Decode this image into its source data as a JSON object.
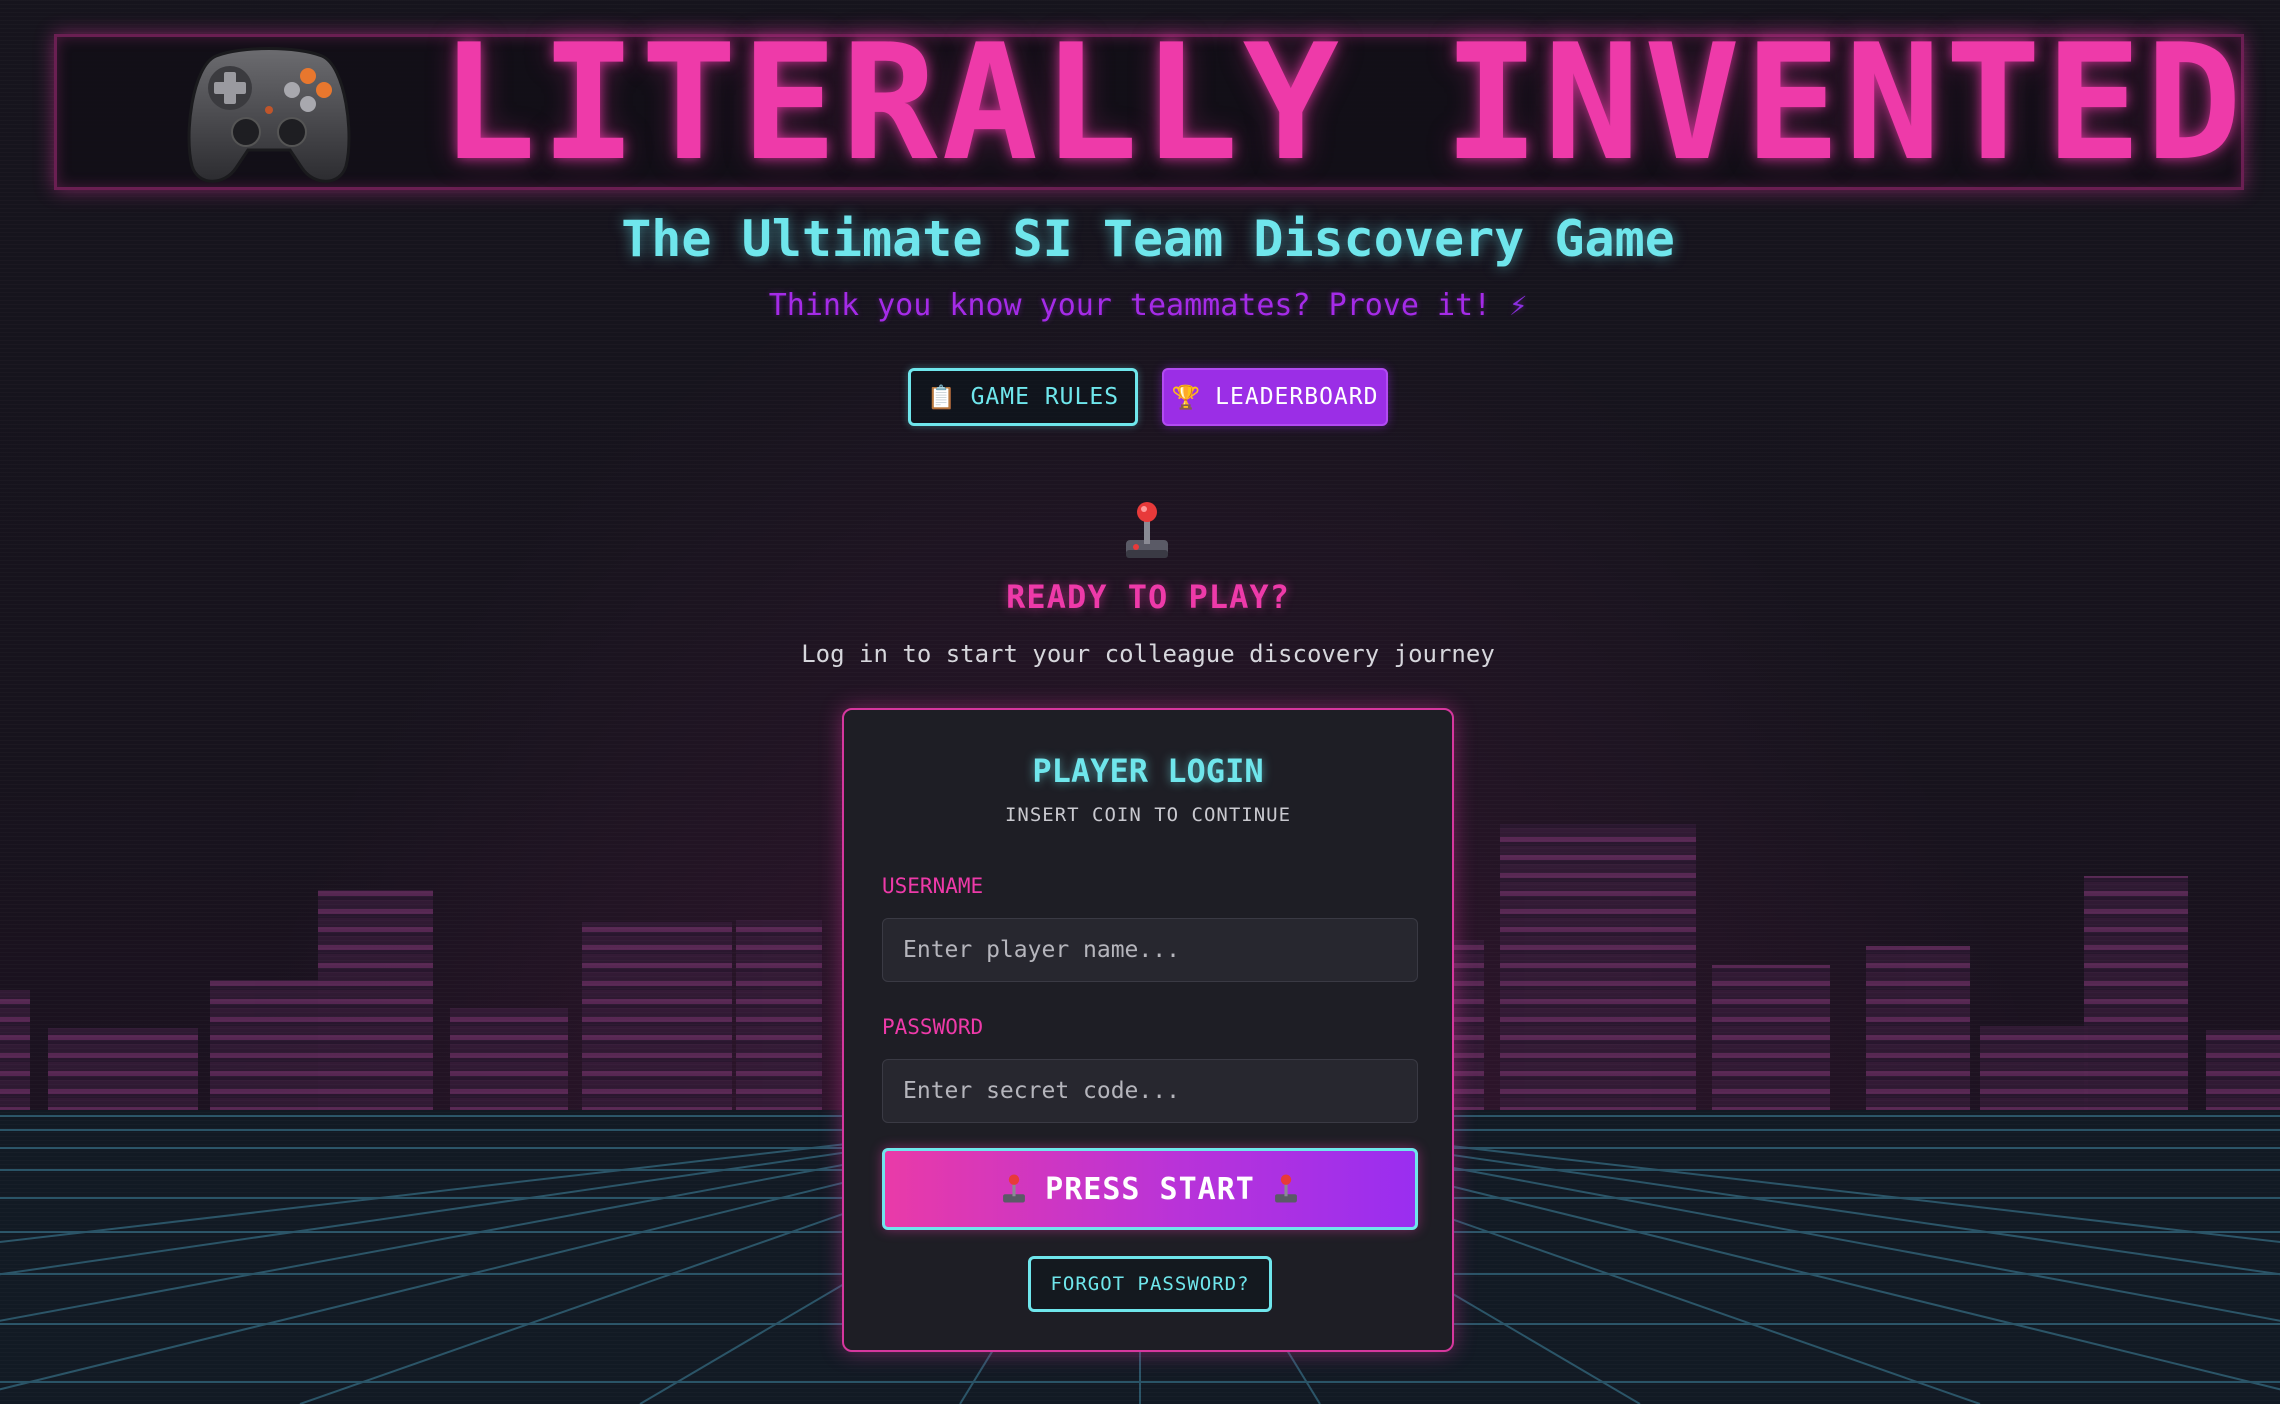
{
  "header": {
    "title": "LITERALLY INVENTED",
    "logo_icon": "gamepad-icon",
    "subtitle": "The Ultimate SI Team Discovery Game",
    "tagline": "Think you know your teammates? Prove it!",
    "tagline_icon": "⚡"
  },
  "nav": {
    "rules_label": "GAME RULES",
    "rules_icon": "📋",
    "leaderboard_label": "LEADERBOARD",
    "leaderboard_icon": "🏆"
  },
  "intro": {
    "icon": "joystick-icon",
    "heading": "READY TO PLAY?",
    "text": "Log in to start your colleague discovery journey"
  },
  "login": {
    "title": "PLAYER LOGIN",
    "subtitle": "INSERT COIN TO CONTINUE",
    "username_label": "USERNAME",
    "username_placeholder": "Enter player name...",
    "username_value": "",
    "password_label": "PASSWORD",
    "password_placeholder": "Enter secret code...",
    "password_value": "",
    "submit_label": "PRESS START",
    "forgot_label": "FORGOT PASSWORD?"
  },
  "colors": {
    "neon_pink": "#ee3aa9",
    "neon_cyan": "#6fe6ec",
    "neon_purple": "#9b2ee6",
    "background": "#15131c"
  }
}
